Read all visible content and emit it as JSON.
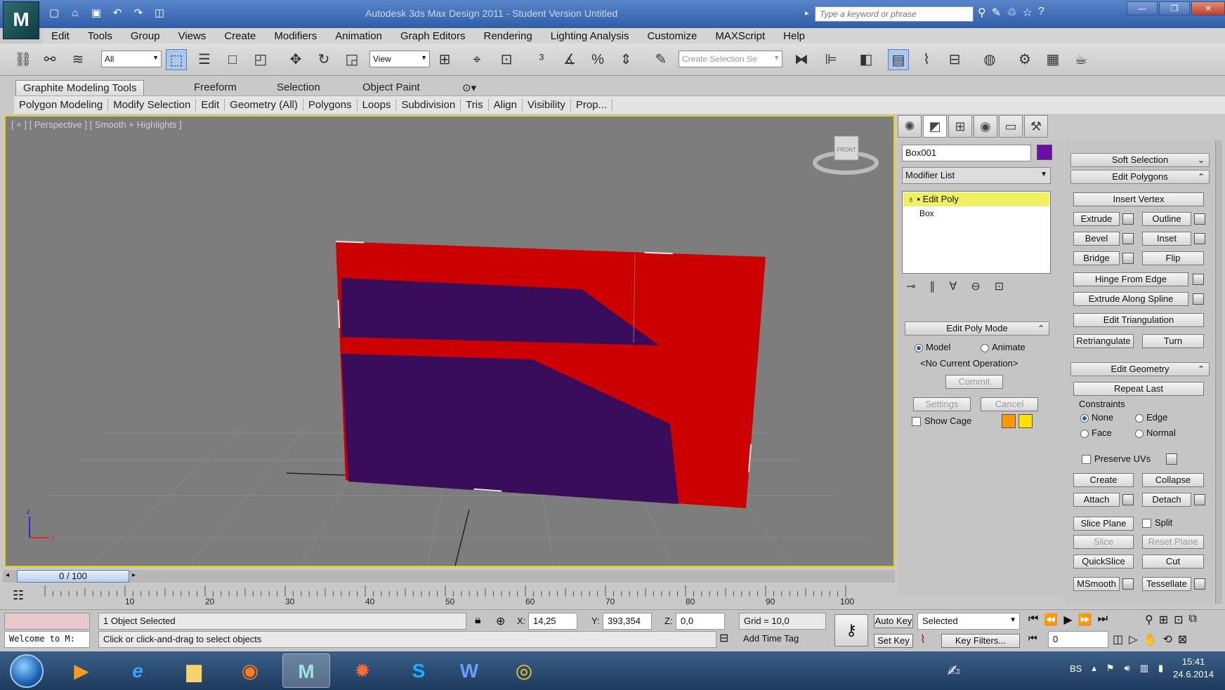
{
  "window": {
    "title": "Autodesk 3ds Max Design 2011 - Student Version   Untitled",
    "search_placeholder": "Type a keyword or phrase",
    "logo_text": "M"
  },
  "menu": [
    "Edit",
    "Tools",
    "Group",
    "Views",
    "Create",
    "Modifiers",
    "Animation",
    "Graph Editors",
    "Rendering",
    "Lighting Analysis",
    "Customize",
    "MAXScript",
    "Help"
  ],
  "toolbar": {
    "selection_filter": "All",
    "reference_coord": "View",
    "named_selection_placeholder": "Create Selection Se"
  },
  "ribbon": {
    "tabs": [
      "Graphite Modeling Tools",
      "Freeform",
      "Selection",
      "Object Paint"
    ],
    "panels": [
      "Polygon Modeling",
      "Modify Selection",
      "Edit",
      "Geometry (All)",
      "Polygons",
      "Loops",
      "Subdivision",
      "Tris",
      "Align",
      "Visibility",
      "Prop..."
    ]
  },
  "viewport": {
    "label": "[ + ] [ Perspective ] [ Smooth + Highlights ]",
    "viewcube_face": "FRONT",
    "axis_z": "z",
    "axis_x": "x"
  },
  "command_panel": {
    "object_name": "Box001",
    "object_color": "#6a0dab",
    "modifier_list_label": "Modifier List",
    "stack": [
      "Edit Poly",
      "Box"
    ],
    "edit_poly_mode": {
      "title": "Edit Poly Mode",
      "model": "Model",
      "animate": "Animate",
      "status": "<No Current Operation>",
      "commit": "Commit",
      "settings": "Settings",
      "cancel": "Cancel",
      "show_cage": "Show Cage",
      "cage_color_1": "#ff9900",
      "cage_color_2": "#ffe000"
    },
    "soft_selection": "Soft Selection",
    "edit_polygons": {
      "title": "Edit Polygons",
      "insert_vertex": "Insert Vertex",
      "extrude": "Extrude",
      "outline": "Outline",
      "bevel": "Bevel",
      "inset": "Inset",
      "bridge": "Bridge",
      "flip": "Flip",
      "hinge": "Hinge From Edge",
      "extrude_spline": "Extrude Along Spline",
      "edit_triangulation": "Edit Triangulation",
      "retriangulate": "Retriangulate",
      "turn": "Turn"
    },
    "edit_geometry": {
      "title": "Edit Geometry",
      "repeat_last": "Repeat Last",
      "constraints": "Constraints",
      "none": "None",
      "edge": "Edge",
      "face": "Face",
      "normal": "Normal",
      "preserve_uvs": "Preserve UVs",
      "create": "Create",
      "collapse": "Collapse",
      "attach": "Attach",
      "detach": "Detach",
      "slice_plane": "Slice Plane",
      "split": "Split",
      "slice": "Slice",
      "reset_plane": "Reset Plane",
      "quickslice": "QuickSlice",
      "cut": "Cut",
      "msmooth": "MSmooth",
      "tessellate": "Tessellate"
    }
  },
  "timeline": {
    "slider_label": "0 / 100",
    "ticks": [
      "0",
      "10",
      "20",
      "30",
      "40",
      "50",
      "60",
      "70",
      "80",
      "90",
      "100"
    ]
  },
  "status": {
    "maxscript_text": "Welcome to M:",
    "selection_info": "1 Object Selected",
    "prompt": "Click or click-and-drag to select objects",
    "x_label": "X:",
    "x_value": "14,25",
    "y_label": "Y:",
    "y_value": "393,354",
    "z_label": "Z:",
    "z_value": "0,0",
    "grid": "Grid = 10,0",
    "add_time_tag": "Add Time Tag",
    "auto_key": "Auto Key",
    "set_key": "Set Key",
    "key_mode": "Selected",
    "key_filters": "Key Filters...",
    "frame": "0"
  },
  "taskbar": {
    "language": "BS",
    "time": "15:41",
    "date": "24.6.2014"
  }
}
